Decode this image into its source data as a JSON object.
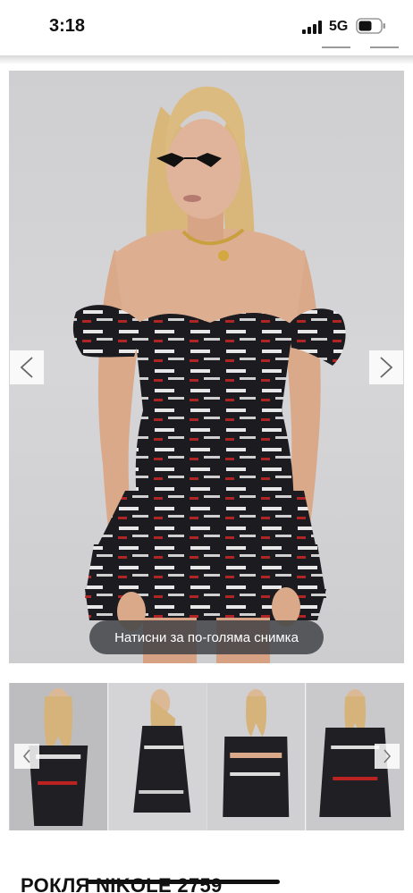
{
  "status_bar": {
    "time": "3:18",
    "network": "5G",
    "icons": [
      "signal-bars-icon",
      "battery-icon"
    ]
  },
  "gallery": {
    "main_image_alt": "model-in-printed-off-shoulder-dress",
    "zoom_hint": "Натисни за по-голяма снимка",
    "prev_icon": "chevron-left-icon",
    "next_icon": "chevron-right-icon",
    "thumbnails_count": 4,
    "colors": {
      "background": "#d2d2d4",
      "dress": "#1c1c20",
      "pill": "#3c3e42"
    }
  },
  "product": {
    "title": "РОКЛЯ NIKOLE 2759"
  }
}
